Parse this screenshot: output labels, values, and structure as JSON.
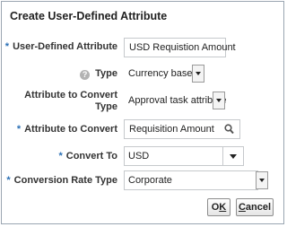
{
  "dialog": {
    "title": "Create User-Defined Attribute"
  },
  "fields": {
    "user_defined_attribute": {
      "label": "User-Defined Attribute",
      "value": "USD Requistion Amount"
    },
    "type": {
      "label": "Type",
      "value": "Currency based"
    },
    "attribute_to_convert_type": {
      "label_line1": "Attribute to Convert",
      "label_line2": "Type",
      "value": "Approval task attribute"
    },
    "attribute_to_convert": {
      "label": "Attribute to Convert",
      "value": "Requisition Amount"
    },
    "convert_to": {
      "label": "Convert To",
      "value": "USD"
    },
    "conversion_rate_type": {
      "label": "Conversion Rate Type",
      "value": "Corporate"
    }
  },
  "required_marker": "*",
  "help_glyph": "?",
  "buttons": {
    "ok": {
      "mnemonic": "K",
      "prefix": "O",
      "suffix": ""
    },
    "cancel": {
      "mnemonic": "C",
      "prefix": "",
      "suffix": "ancel"
    }
  },
  "icons": {
    "search": "search-icon",
    "help": "help-icon",
    "dropdown": "chevron-down-icon"
  }
}
